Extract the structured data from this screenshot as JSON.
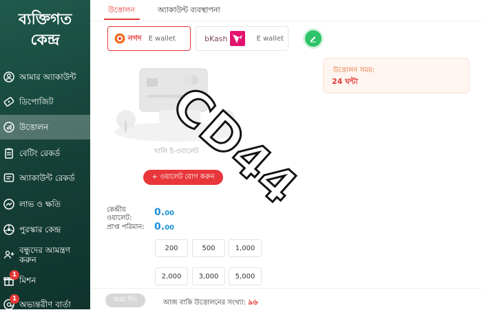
{
  "sidebar": {
    "title_line1": "ব্যক্তিগত",
    "title_line2": "কেন্দ্র",
    "items": [
      {
        "label": "আমার অ্যাকাউন্ট",
        "icon": "account-icon"
      },
      {
        "label": "ডিপোজিট",
        "icon": "deposit-icon"
      },
      {
        "label": "উত্তোলন",
        "icon": "withdraw-icon",
        "active": true
      },
      {
        "label": "বেটিং রেকর্ড",
        "icon": "betting-record-icon"
      },
      {
        "label": "অ্যাকাউন্ট রেকর্ড",
        "icon": "account-record-icon"
      },
      {
        "label": "লাভ ও ক্ষতি",
        "icon": "profit-loss-icon"
      },
      {
        "label": "পুরস্কার কেন্দ্র",
        "icon": "reward-center-icon"
      },
      {
        "label_line1": "বন্ধুদের আমন্ত্রণ",
        "label_line2": "করুন",
        "icon": "invite-friends-icon"
      },
      {
        "label": "মিশন",
        "icon": "mission-icon",
        "badge": "1"
      },
      {
        "label": "অভ্যন্তরীণ বার্তা",
        "icon": "messages-icon",
        "badge": "1"
      }
    ]
  },
  "tabs": {
    "withdraw": "উত্তোলন",
    "account_management": "অ্যাকাউন্ট ব্যবস্থাপনা"
  },
  "wallets": {
    "nagad_name": "নগদ",
    "nagad_type": "E wallet",
    "bkash_name": "bKash",
    "bkash_type": "E wallet"
  },
  "empty_wallet_text": "খালি ই-ওয়ালেট",
  "add_wallet_button": "+ ওয়ালেট যোগ করুন",
  "withdraw_time": {
    "label": "উত্তোলন সময়:",
    "value": "24 ঘন্টা"
  },
  "watermark": "CD44",
  "balances": {
    "central_wallet_line1": "কেন্দ্রীয়",
    "central_wallet_line2": "ওয়ালেট:",
    "central_wallet_int": "0.",
    "central_wallet_dec": "00",
    "received_amount_label": "প্রাপ্ত পরিমান:",
    "received_amount_int": "0.",
    "received_amount_dec": "00"
  },
  "amounts": [
    "200",
    "500",
    "1,000",
    "2,000",
    "3,000",
    "5,000"
  ],
  "footer": {
    "submit_button": "জমা দিন",
    "remaining_label": "আজ বাকি উত্তোলনের সংখ্যা:",
    "remaining_count": "৯৬"
  },
  "colors": {
    "accent": "#e53935",
    "sidebar_bg": "#184a3f",
    "balance_blue": "#1a8fd8",
    "edit_green": "#2fc36a"
  }
}
